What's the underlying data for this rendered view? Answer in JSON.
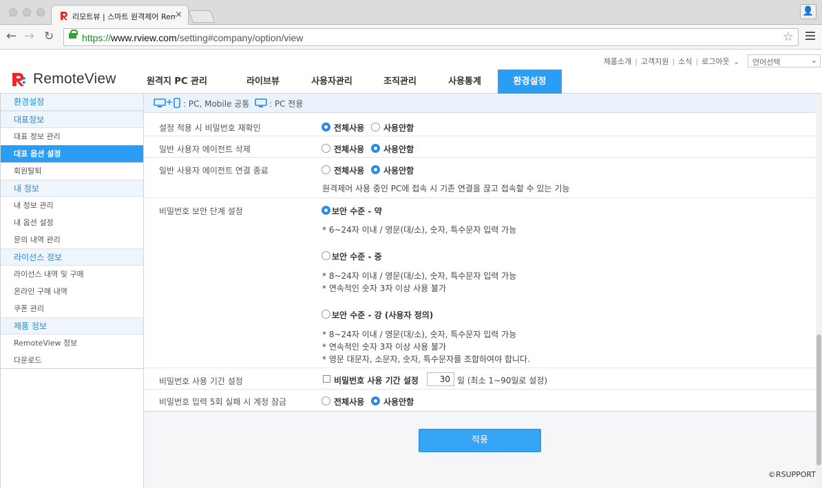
{
  "browser": {
    "tab_title": "리모트뷰 | 스마트 원격제어 RemoteView",
    "tab_close": "×",
    "url_protocol": "https://",
    "url_host": "www.rview.com",
    "url_path": "/setting#company/option/view"
  },
  "header": {
    "logo_text": "RemoteView",
    "util_links": [
      "제품소개",
      "고객지원",
      "소식",
      "로그아웃"
    ],
    "language_select": "언어선택",
    "nav": [
      {
        "label": "원격지 PC 관리"
      },
      {
        "label": "라이브뷰"
      },
      {
        "label": "사용자관리"
      },
      {
        "label": "조직관리"
      },
      {
        "label": "사용통계"
      },
      {
        "label": "환경설정"
      }
    ]
  },
  "sidebar": {
    "title": "환경설정",
    "groups": [
      {
        "title": "대표정보",
        "items": [
          "대표 정보 관리",
          "대표 옵션 설정",
          "회원탈퇴"
        ]
      },
      {
        "title": "내 정보",
        "items": [
          "내 정보 관리",
          "내 옵션 설정",
          "문의 내역 관리"
        ]
      },
      {
        "title": "라이선스 정보",
        "items": [
          "라이선스 내역 및 구매",
          "온라인 구매 내역",
          "쿠폰 관리"
        ]
      },
      {
        "title": "제품 정보",
        "items": [
          "RemoteView 정보",
          "다운로드"
        ]
      }
    ]
  },
  "legend": {
    "plus": "+",
    "common": ": PC, Mobile 공통",
    "pc_only": ": PC 전용"
  },
  "settings": {
    "row1": {
      "label": "설정 적용 시 비밀번호 재확인",
      "opt1": "전체사용",
      "opt2": "사용안함"
    },
    "row2": {
      "label": "일반 사용자 에이전트 삭제",
      "opt1": "전체사용",
      "opt2": "사용안함"
    },
    "row3": {
      "label": "일반 사용자 에이전트 연결 종료",
      "opt1": "전체사용",
      "opt2": "사용안함",
      "note": "원격제어 사용 중인 PC에 접속 시 기존 연결을 끊고 접속할 수 있는 기능"
    },
    "row4": {
      "label": "비밀번호 보안 단계 설정",
      "low": {
        "title": "보안 수준 - 약",
        "notes": [
          "* 6~24자 이내 / 영문(대/소), 숫자, 특수문자 입력 가능"
        ]
      },
      "mid": {
        "title": "보안 수준 - 중",
        "notes": [
          "* 8~24자 이내 / 영문(대/소), 숫자, 특수문자 입력 가능",
          "* 연속적인 숫자 3자 이상 사용 불가"
        ]
      },
      "high": {
        "title": "보안 수준 - 강 (사용자 정의)",
        "notes": [
          "* 8~24자 이내 / 영문(대/소), 숫자, 특수문자 입력 가능",
          "* 연속적인 숫자 3자 이상 사용 불가",
          "* 영문 대문자, 소문자, 숫자, 특수문자를 조합하여야 합니다."
        ]
      }
    },
    "row5": {
      "label": "비밀번호 사용 기간 설정",
      "checkbox_label": "비밀번호 사용 기간 설정",
      "days": "30",
      "suffix": "일 (최소 1~90일로 설정)"
    },
    "row6": {
      "label": "비밀번호 입력 5회 실패 시 계정 잠금",
      "opt1": "전체사용",
      "opt2": "사용안함"
    }
  },
  "apply_button": "적용",
  "copyright": "©RSUPPORT"
}
